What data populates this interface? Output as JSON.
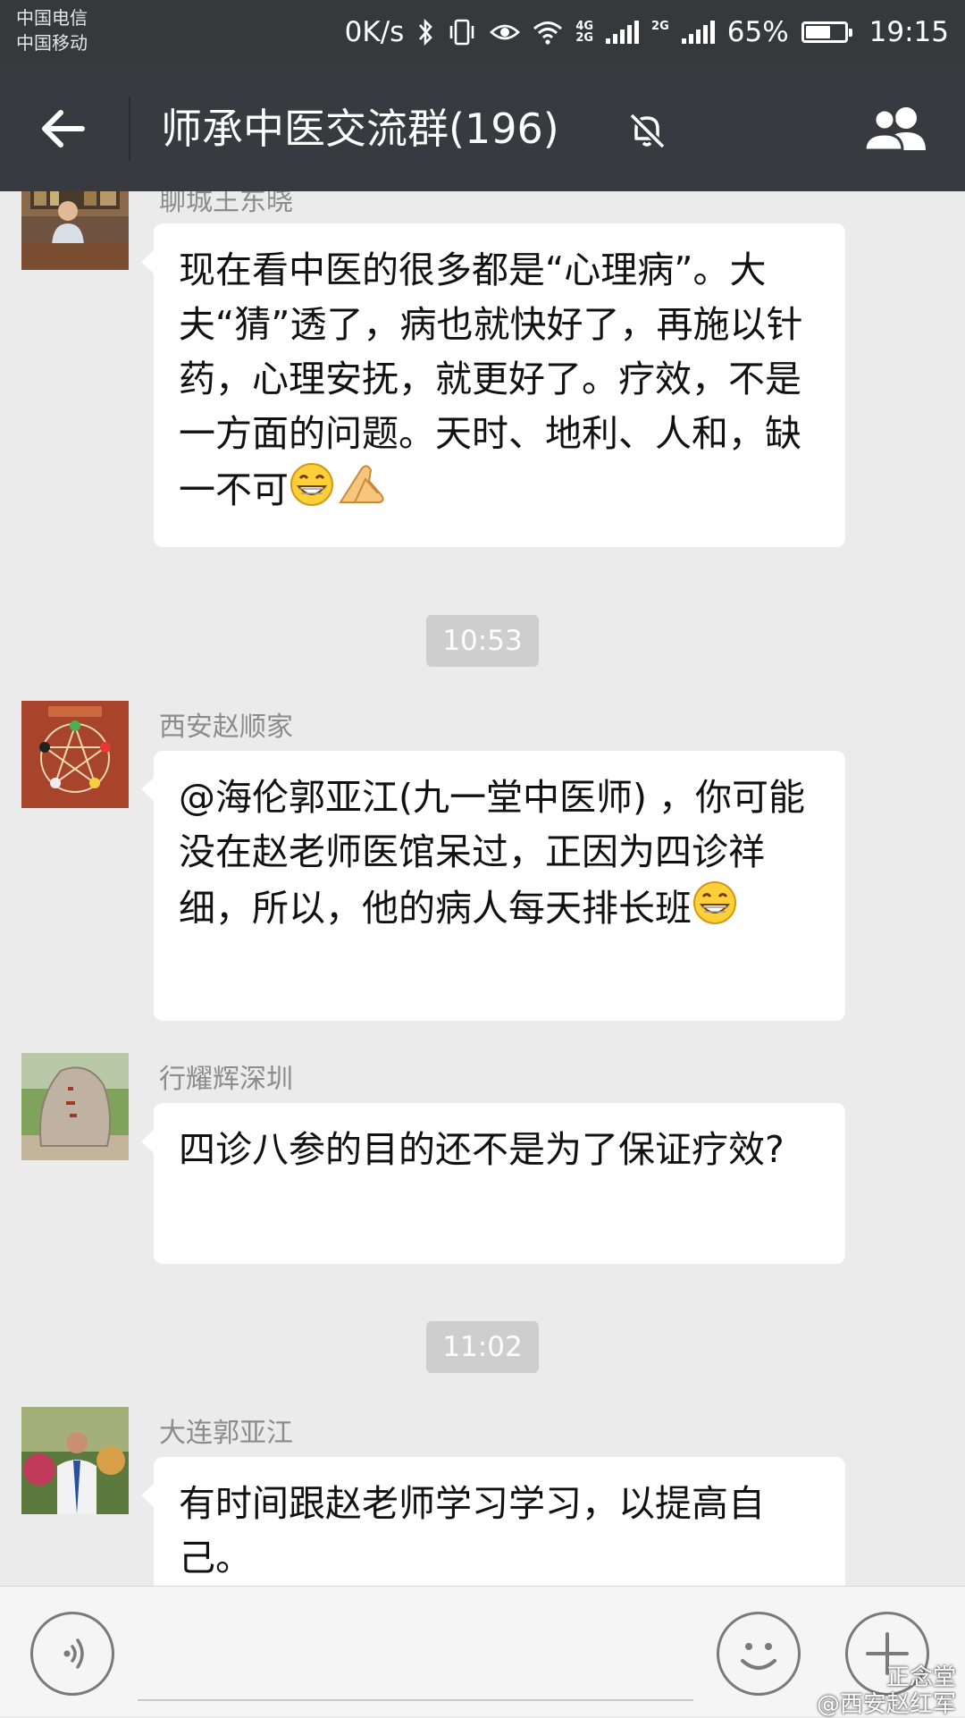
{
  "status_bar": {
    "carrier_1": "中国电信",
    "carrier_2": "中国移动",
    "net_speed": "0K/s",
    "net_1_top": "4G",
    "net_1_bottom": "2G",
    "net_2": "2G",
    "battery_percent": "65%",
    "battery_level": 0.65,
    "time": "19:15"
  },
  "header": {
    "title": "师承中医交流群(196)",
    "back_icon": "arrow-left-icon",
    "mute_icon": "bell-muted-icon",
    "members_icon": "group-members-icon"
  },
  "messages": [
    {
      "sender": "聊城王东晓",
      "text": "现在看中医的很多都是“心理病”。大夫“猜”透了，病也就快好了，再施以针药，心理安抚，就更好了。疗效，不是一方面的问题。天时、地利、人和，缺一不可",
      "emojis": [
        "grin-emoji",
        "praying-hands-emoji"
      ]
    },
    {
      "time": "10:53"
    },
    {
      "sender": "西安赵顺家",
      "text": "@海伦郭亚江(九一堂中医师) ，你可能没在赵老师医馆呆过，正因为四诊祥细，所以，他的病人每天排长班",
      "emojis": [
        "grin-emoji"
      ]
    },
    {
      "sender": "行耀辉深圳",
      "text": "四诊八参的目的还不是为了保证疗效?"
    },
    {
      "time": "11:02"
    },
    {
      "sender": "大连郭亚江",
      "text": "有时间跟赵老师学习学习，以提高自己。"
    }
  ],
  "input_bar": {
    "voice_icon": "voice-input-icon",
    "emoji_icon": "emoji-icon",
    "more_icon": "plus-icon"
  },
  "watermark": {
    "line_1": "正念堂",
    "line_2": "@西安赵红军"
  },
  "colors": {
    "title_bar": "#393a3f",
    "status_bar": "#36393b",
    "chat_background": "#ebebeb",
    "bubble": "#ffffff",
    "time_chip": "#cecece"
  }
}
